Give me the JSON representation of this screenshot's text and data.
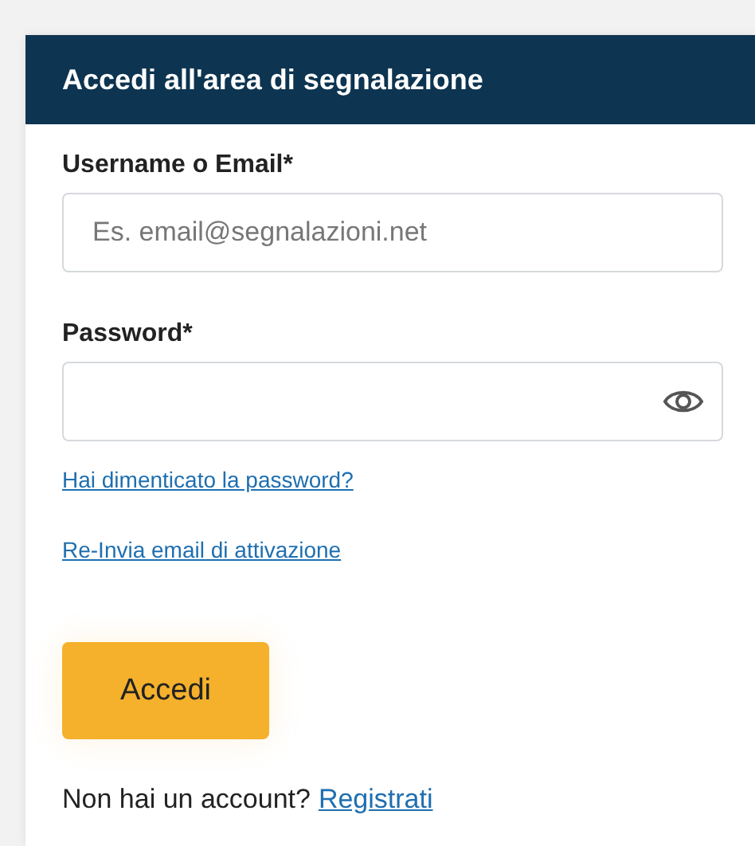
{
  "header": {
    "title": "Accedi all'area di segnalazione"
  },
  "fields": [
    {
      "label": "Username o Email*",
      "placeholder": "Es. email@segnalazioni.net",
      "kind": "text"
    },
    {
      "label": "Password*",
      "kind": "password"
    }
  ],
  "links": [
    "Hai dimenticato la password?",
    "Re-Invia email di attivazione"
  ],
  "submit": "Accedi",
  "signup": {
    "text": "Non hai un account?",
    "link": "Registrati"
  }
}
